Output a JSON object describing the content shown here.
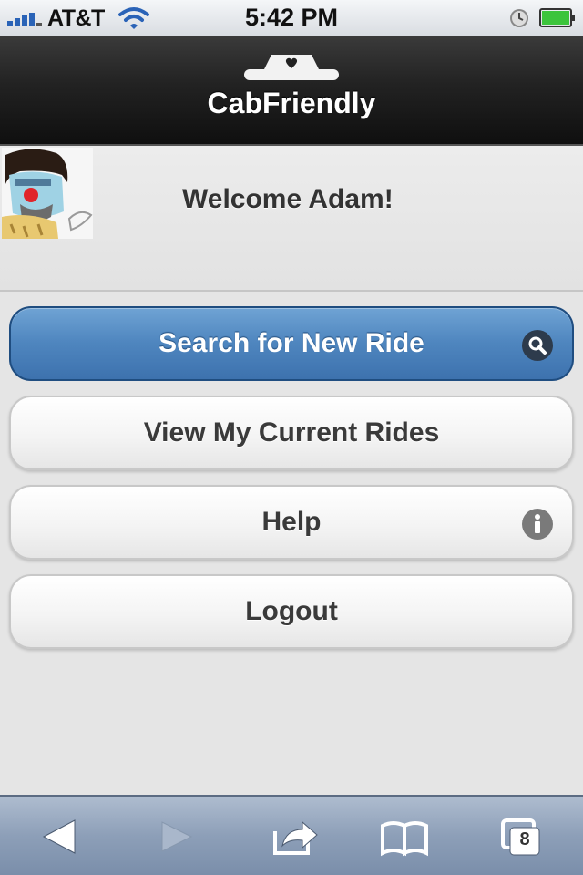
{
  "status_bar": {
    "carrier": "AT&T",
    "time": "5:42 PM",
    "icons": [
      "signal-icon",
      "wifi-icon",
      "clock-icon",
      "battery-icon"
    ]
  },
  "header": {
    "title": "CabFriendly",
    "logo_icon": "cab-heart-logo"
  },
  "profile": {
    "welcome": "Welcome Adam!"
  },
  "menu": {
    "search": "Search for New Ride",
    "current": "View My Current Rides",
    "help": "Help",
    "logout": "Logout"
  },
  "toolbar": {
    "tab_count": "8",
    "icons": [
      "back-icon",
      "forward-icon",
      "share-icon",
      "bookmarks-icon",
      "tabs-icon"
    ]
  },
  "colors": {
    "primary_button": "#4f86bf",
    "header_bg": "#1a1a1a",
    "page_bg": "#e5e5e5",
    "toolbar_bg": "#8d9fb8"
  }
}
